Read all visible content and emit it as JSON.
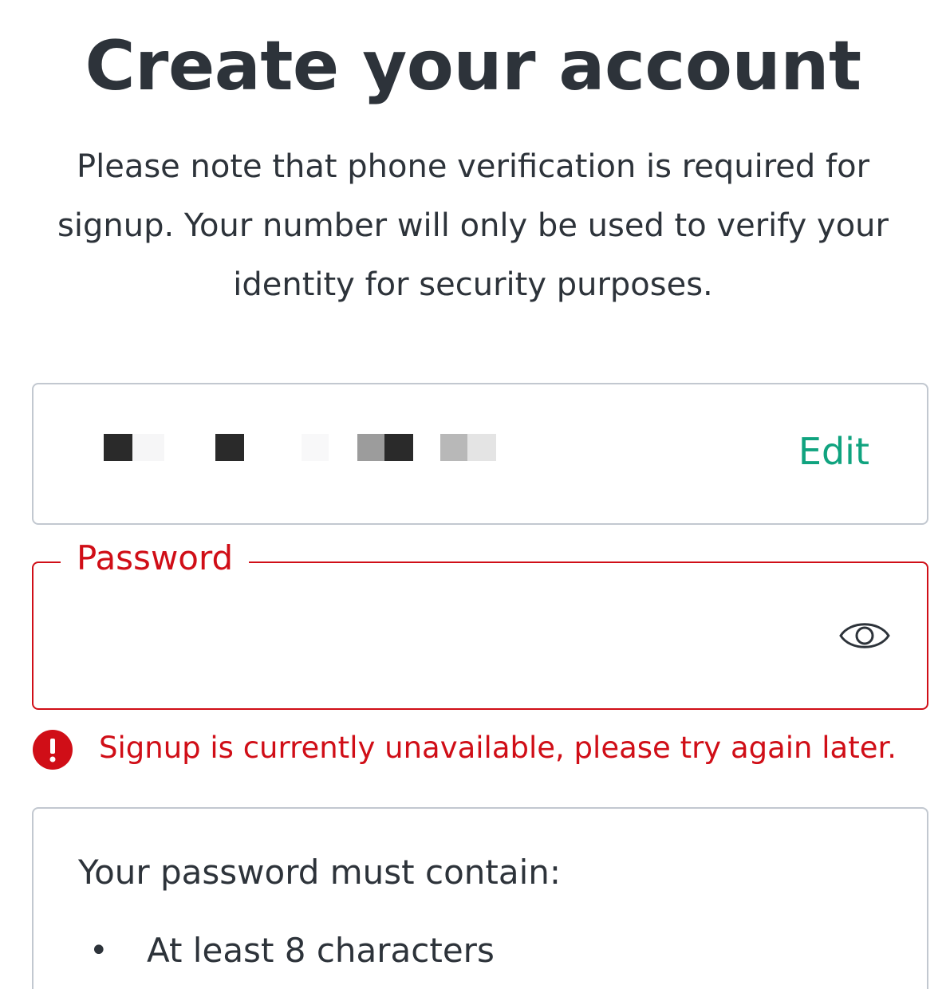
{
  "page": {
    "title": "Create your account",
    "subtitle": "Please note that phone verification is required for signup. Your number will only be used to verify your identity for security purposes."
  },
  "phone": {
    "edit_label": "Edit"
  },
  "password": {
    "label": "Password",
    "value": "",
    "visibility_icon": "eye-icon"
  },
  "error": {
    "icon": "alert-icon",
    "message": "Signup is currently unavailable, please try again later."
  },
  "requirements": {
    "title": "Your password must contain:",
    "items": [
      {
        "bullet": "•",
        "text": "At least 8 characters"
      }
    ]
  },
  "colors": {
    "accent": "#10a37f",
    "error": "#d00e17",
    "border": "#c2c8d0",
    "text": "#2d333a"
  }
}
